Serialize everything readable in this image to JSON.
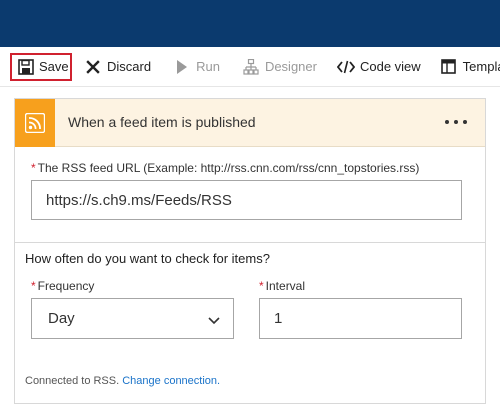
{
  "toolbar": {
    "save_label": "Save",
    "discard_label": "Discard",
    "run_label": "Run",
    "designer_label": "Designer",
    "codeview_label": "Code view",
    "templates_label": "Templates"
  },
  "trigger": {
    "title": "When a feed item is published",
    "icon": "rss-icon",
    "accent_color": "#f7a01d",
    "header_bg": "#fdf3e2"
  },
  "feed_url": {
    "required_mark": "*",
    "label": "The RSS feed URL (Example: http://rss.cnn.com/rss/cnn_topstories.rss)",
    "value": "https://s.ch9.ms/Feeds/RSS"
  },
  "recurrence": {
    "question": "How often do you want to check for items?",
    "frequency": {
      "required_mark": "*",
      "label": "Frequency",
      "value": "Day"
    },
    "interval": {
      "required_mark": "*",
      "label": "Interval",
      "value": "1"
    }
  },
  "connection": {
    "text": "Connected to RSS.",
    "link_label": "Change connection."
  },
  "colors": {
    "topbar": "#0b3a6e",
    "required": "#d0212f",
    "link": "#1a73c9"
  }
}
